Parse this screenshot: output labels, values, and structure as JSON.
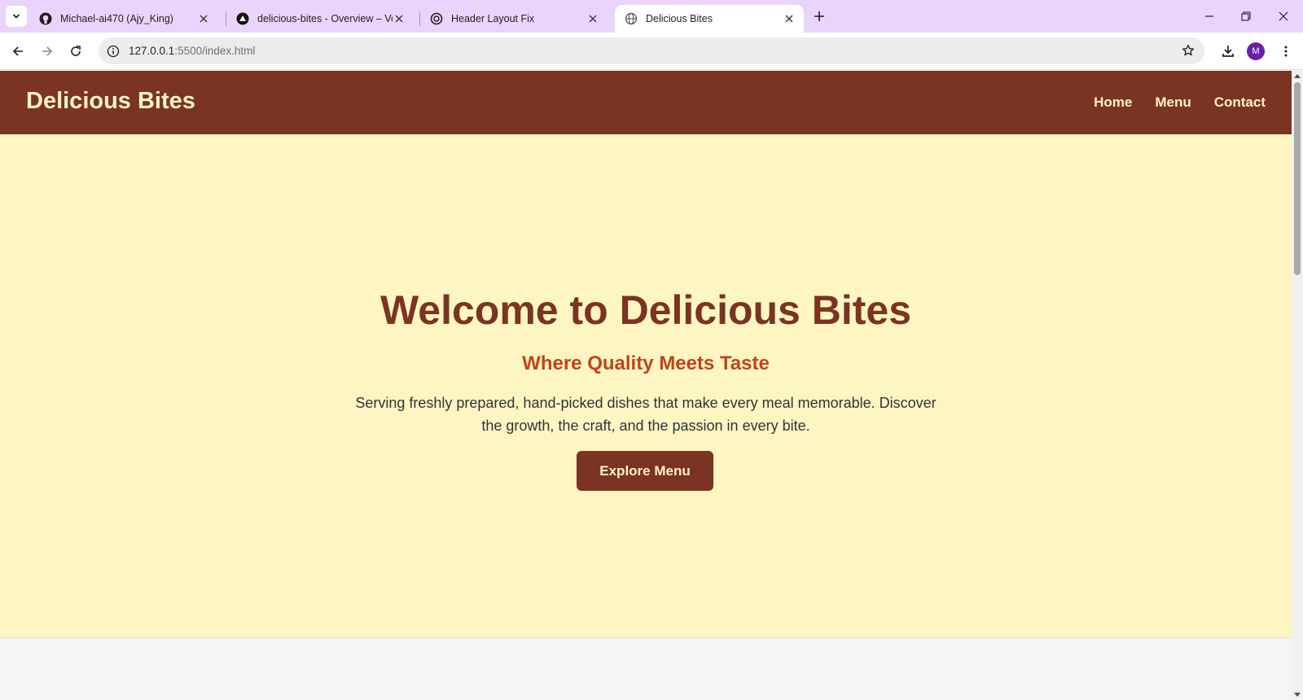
{
  "browser": {
    "tabs": [
      {
        "title": "Michael-ai470 (Ajy_King)",
        "icon": "github-icon",
        "active": false
      },
      {
        "title": "delicious-bites - Overview – Vercel",
        "icon": "vercel-icon",
        "active": false
      },
      {
        "title": "Header Layout Fix",
        "icon": "openai-icon",
        "active": false
      },
      {
        "title": "Delicious Bites",
        "icon": "globe-icon",
        "active": true
      }
    ],
    "url_host": "127.0.0.1",
    "url_rest": ":5500/index.html",
    "profile_initial": "M",
    "theme_color": "#e9d5fb"
  },
  "site": {
    "logo": "Delicious Bites",
    "nav": [
      "Home",
      "Menu",
      "Contact"
    ],
    "hero": {
      "title": "Welcome to Delicious Bites",
      "subtitle": "Where Quality Meets Taste",
      "description": "Serving freshly prepared, hand-picked dishes that make every meal memorable. Discover the growth, the craft, and the passion in every bite.",
      "cta_label": "Explore Menu"
    },
    "colors": {
      "primary": "#7b3322",
      "accent": "#c1431b",
      "hero_bg": "#fdf6c3",
      "header_text": "#fdf4c7"
    }
  }
}
